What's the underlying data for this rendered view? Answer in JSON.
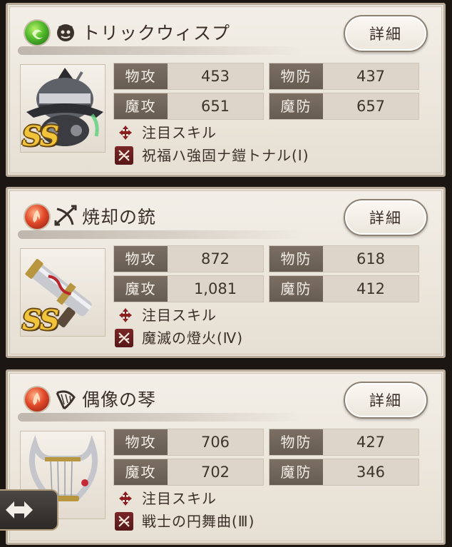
{
  "cards": [
    {
      "name": "トリックウィスプ",
      "element": "wind",
      "rank": "SS",
      "detail_label": "詳細",
      "stats": {
        "patk_label": "物攻",
        "patk": "453",
        "pdef_label": "物防",
        "pdef": "437",
        "matk_label": "魔攻",
        "matk": "651",
        "mdef_label": "魔防",
        "mdef": "657"
      },
      "focus_skill": "注目スキル",
      "ability": "祝福ハ強固ナ鎧トナル(Ⅰ)"
    },
    {
      "name": "焼却の銃",
      "element": "fire",
      "rank": "SS",
      "detail_label": "詳細",
      "stats": {
        "patk_label": "物攻",
        "patk": "872",
        "pdef_label": "物防",
        "pdef": "618",
        "matk_label": "魔攻",
        "matk": "1,081",
        "mdef_label": "魔防",
        "mdef": "412"
      },
      "focus_skill": "注目スキル",
      "ability": "魔滅の燈火(Ⅳ)"
    },
    {
      "name": "偶像の琴",
      "element": "fire",
      "detail_label": "詳細",
      "stats": {
        "patk_label": "物攻",
        "patk": "706",
        "pdef_label": "物防",
        "pdef": "427",
        "matk_label": "魔攻",
        "matk": "702",
        "mdef_label": "魔防",
        "mdef": "346"
      },
      "focus_skill": "注目スキル",
      "ability": "戦士の円舞曲(Ⅲ)"
    }
  ],
  "colors": {
    "wind": "#4fb82a",
    "fire": "#e24a2a",
    "rank_gold": "#f2c43b",
    "label_bg": "#71665b"
  }
}
